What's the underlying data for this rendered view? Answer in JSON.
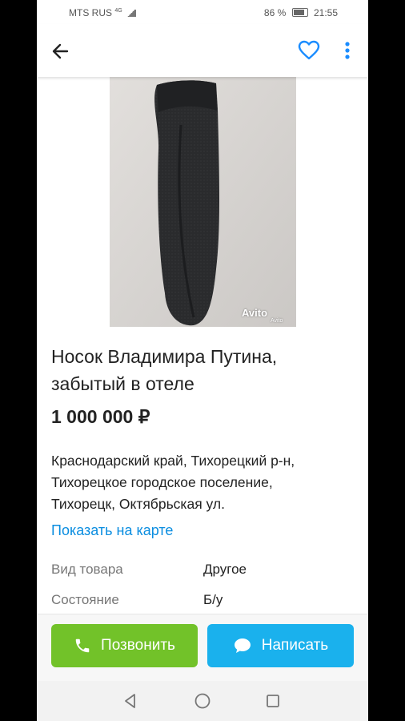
{
  "status": {
    "carrier": "MTS RUS",
    "network": "4G",
    "battery": "86 %",
    "time": "21:55"
  },
  "toolbar": {
    "back_icon": "arrow-left-icon",
    "favorite_icon": "heart-icon",
    "more_icon": "more-vertical-icon",
    "accent": "#1a8cff"
  },
  "photo": {
    "watermark": "Avito",
    "watermark_sub": "Avito"
  },
  "listing": {
    "title": "Носок Владимира Путина, забытый в отеле",
    "price": "1 000 000 ₽",
    "address_lines": [
      "Краснодарский край, Тихорецкий р-н,",
      "Тихорецкое городское поселение,",
      "Тихорецк, Октябрьская ул."
    ],
    "map_link": "Показать на карте",
    "specs": [
      {
        "key": "Вид товара",
        "value": "Другое"
      },
      {
        "key": "Состояние",
        "value": "Б/у"
      }
    ]
  },
  "actions": {
    "call_label": "Позвонить",
    "call_color": "#72c229",
    "message_label": "Написать",
    "message_color": "#1ab1ed"
  },
  "navbar": {
    "back": "triangle-back-icon",
    "home": "circle-home-icon",
    "recents": "square-recents-icon"
  }
}
